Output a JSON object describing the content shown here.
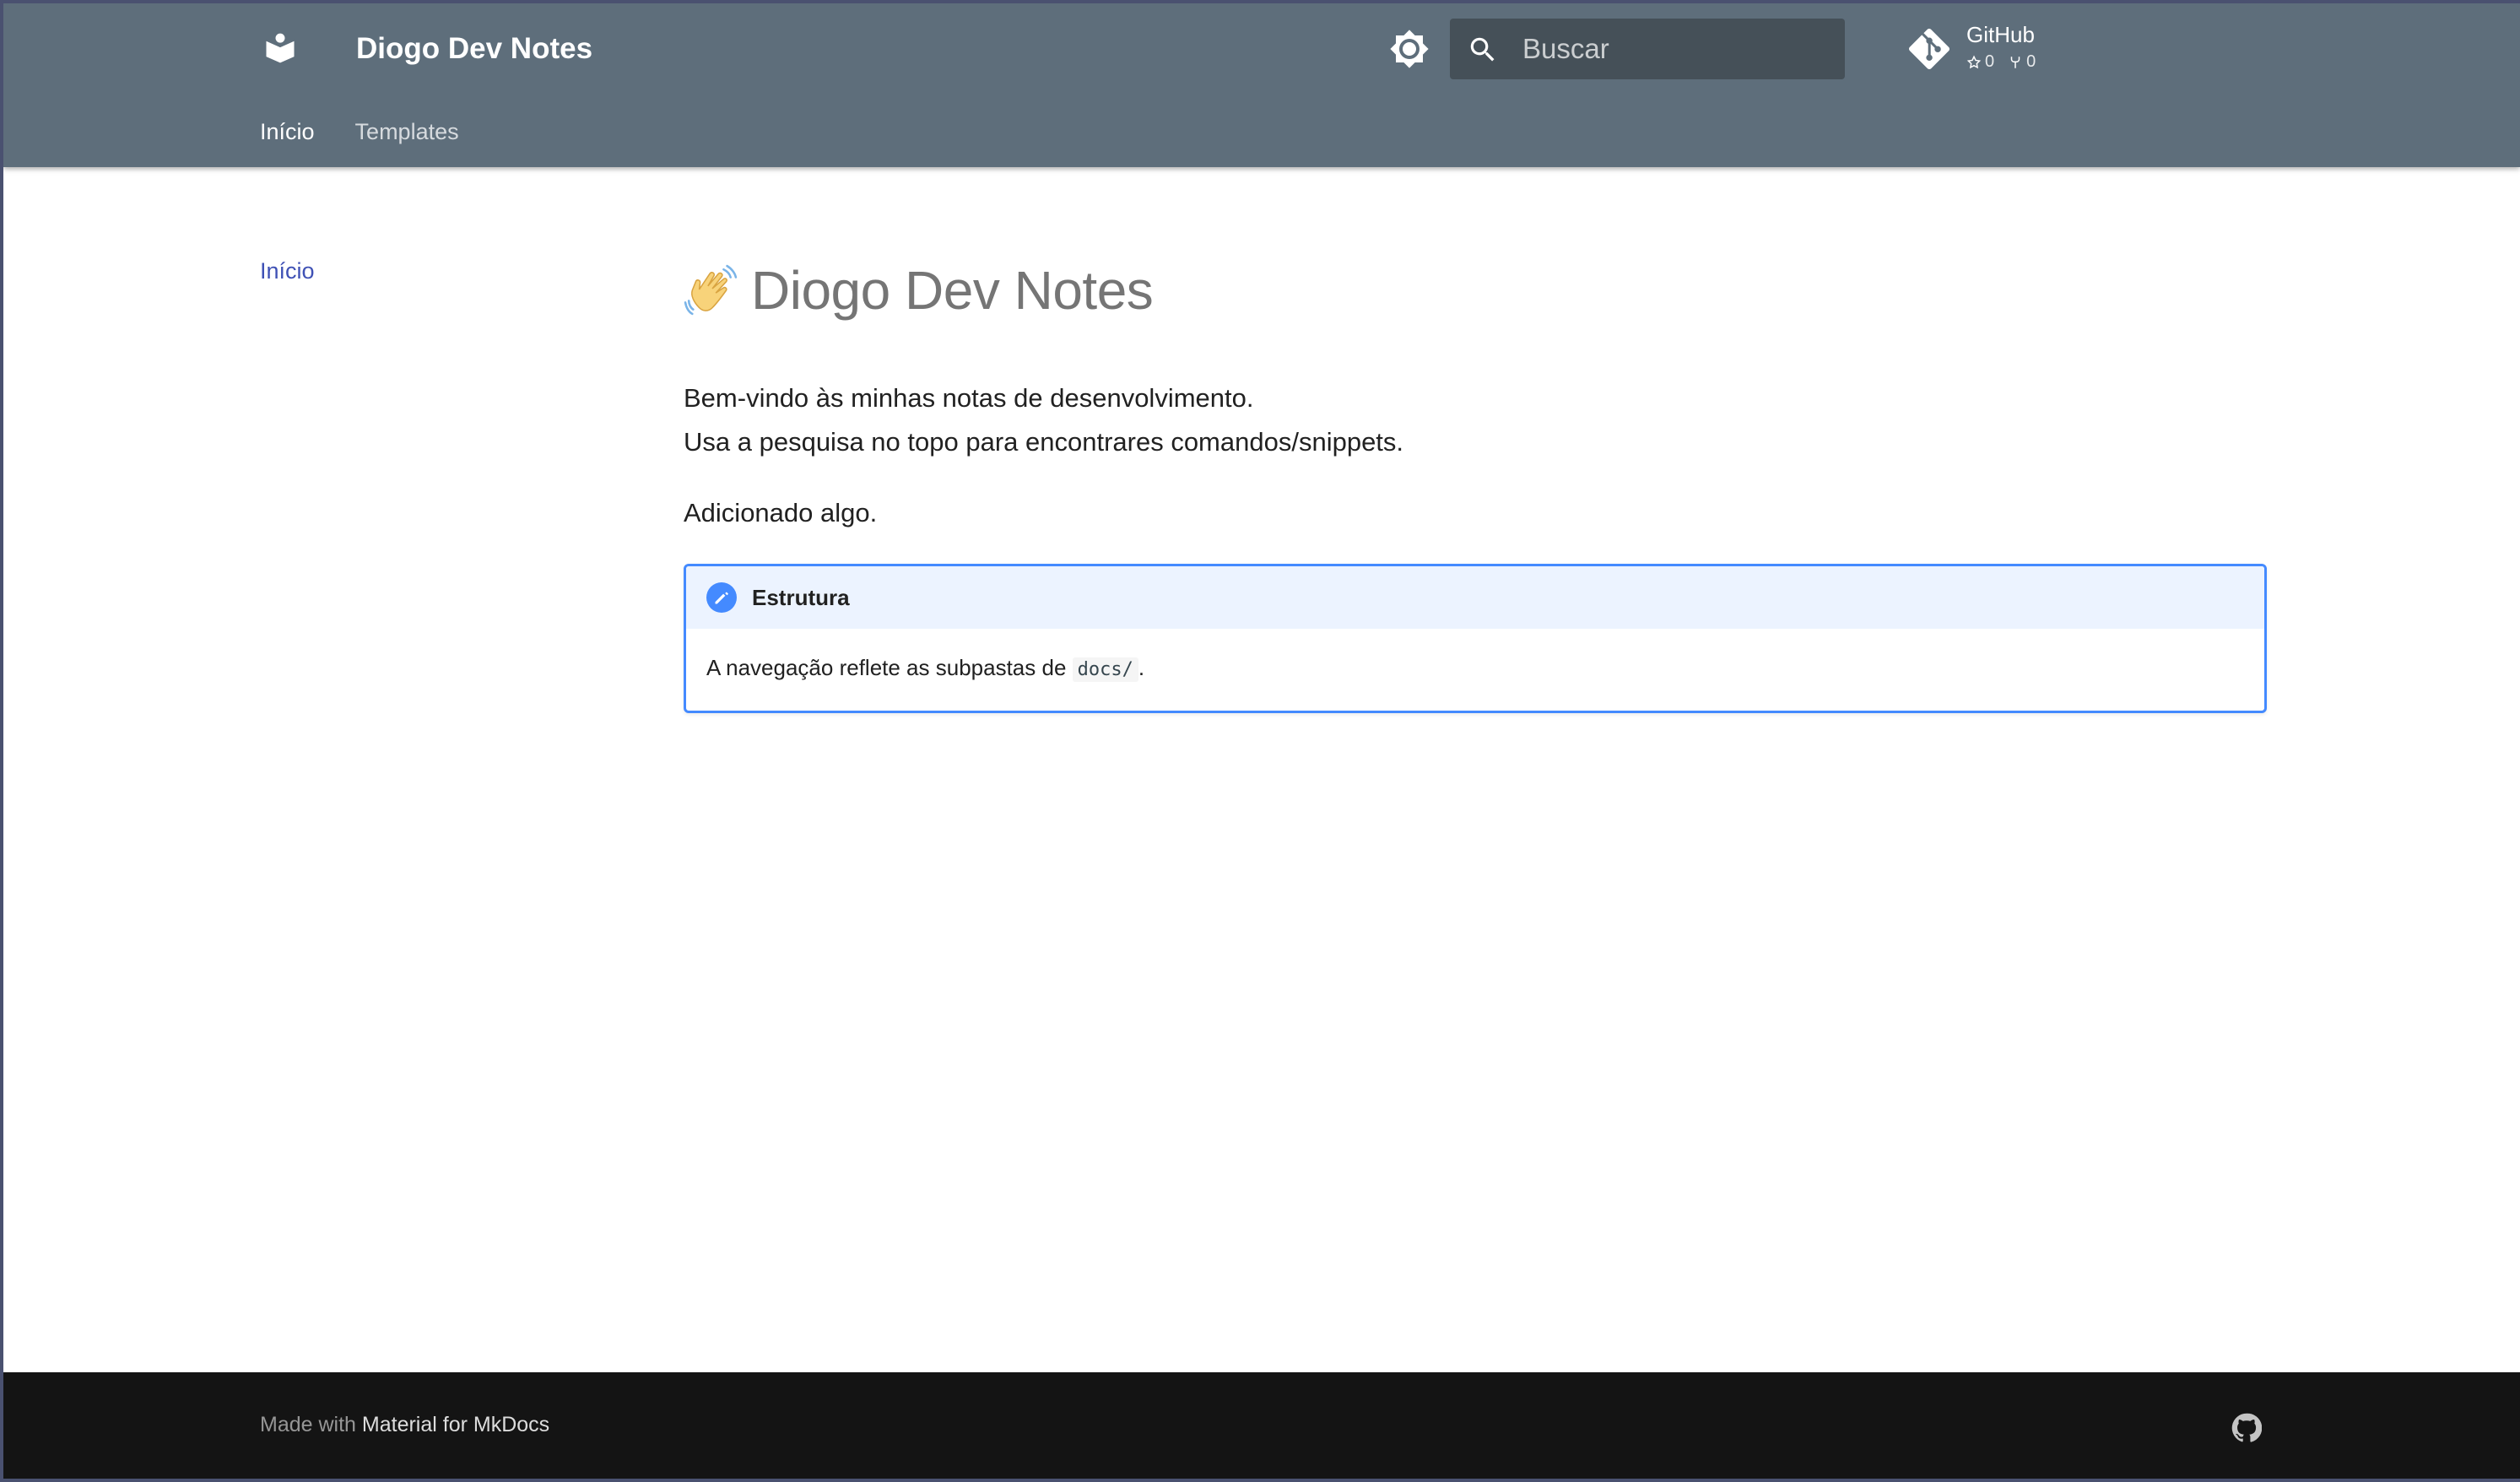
{
  "header": {
    "logo_icon": "book-reader-icon",
    "site_title": "Diogo Dev Notes",
    "theme_toggle_icon": "brightness-icon",
    "search": {
      "placeholder": "Buscar",
      "value": "",
      "icon": "search-icon"
    },
    "repo": {
      "name": "GitHub",
      "stars": "0",
      "forks": "0",
      "icon": "git-icon"
    },
    "tabs": [
      {
        "label": "Início",
        "active": true
      },
      {
        "label": "Templates",
        "active": false
      }
    ]
  },
  "sidebar": {
    "items": [
      {
        "label": "Início",
        "active": true
      }
    ]
  },
  "main": {
    "title_emoji": "waving-hand-icon",
    "title": "Diogo Dev Notes",
    "paragraphs": [
      "Bem-vindo às minhas notas de desenvolvimento.",
      "Usa a pesquisa no topo para encontrares comandos/snippets.",
      "Adicionado algo."
    ],
    "admonition": {
      "type": "note",
      "icon": "pencil-icon",
      "title": "Estrutura",
      "body_text": "A navegação reflete as subpastas de ",
      "code": "docs/",
      "body_end": "."
    }
  },
  "footer": {
    "made_with": "Made with",
    "link_text": "Material for MkDocs",
    "social_icon": "github-icon"
  },
  "colors": {
    "header_bg": "#5e6e7b",
    "search_bg": "#455058",
    "accent": "#3f51b5",
    "admonition_border": "#448aff",
    "admonition_title_bg": "#ecf3ff",
    "footer_bg": "#141414"
  }
}
